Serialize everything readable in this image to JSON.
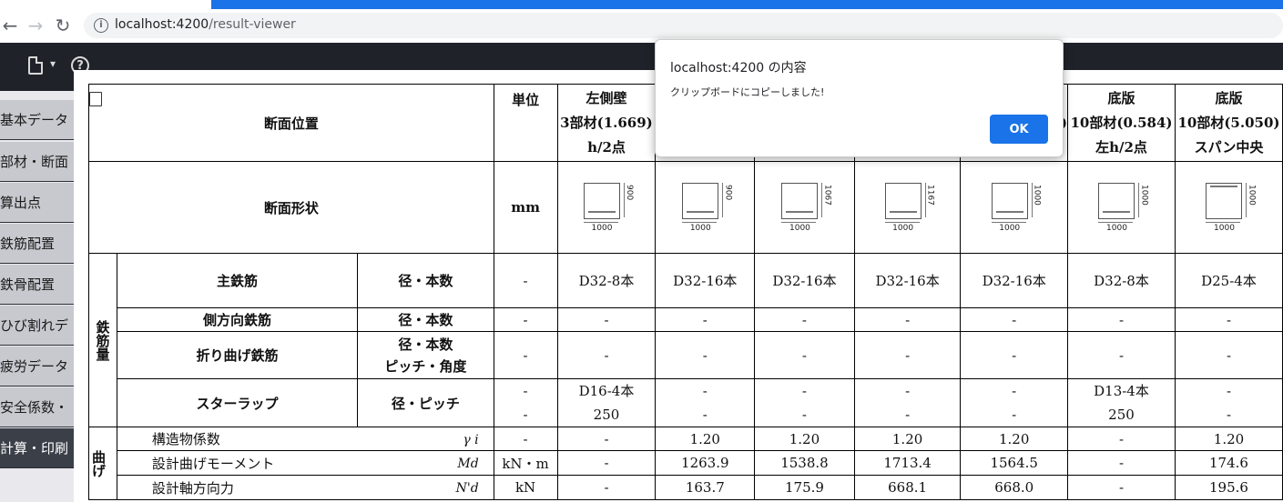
{
  "browser": {
    "url_host": "localhost:4200",
    "url_path": "/result-viewer",
    "back_glyph": "←",
    "forward_glyph": "→",
    "reload_glyph": "↻",
    "info_glyph": "i"
  },
  "toolbar": {
    "caret": "▾",
    "help": "?"
  },
  "sidebar": {
    "items": [
      {
        "label": "基本データ"
      },
      {
        "label": "部材・断面"
      },
      {
        "label": "算出点"
      },
      {
        "label": "鉄筋配置"
      },
      {
        "label": "鉄骨配置"
      },
      {
        "label": "ひび割れデ"
      },
      {
        "label": "疲労データ"
      },
      {
        "label": "安全係数・"
      },
      {
        "label": "計算・印刷"
      }
    ]
  },
  "table": {
    "h_position": "断面位置",
    "h_unit": "単位",
    "columns": [
      {
        "l1": "左側壁",
        "l2": "3部材(1.669)",
        "l3": "h/2点"
      },
      {
        "l1": "",
        "l2": "",
        "l3": ""
      },
      {
        "l1": "",
        "l2": "",
        "l3": ""
      },
      {
        "l1": "",
        "l2": "",
        "l3": ""
      },
      {
        "l1": "",
        "l2": ")",
        "l3": ""
      },
      {
        "l1": "底版",
        "l2": "10部材(0.584)",
        "l3": "左h/2点"
      },
      {
        "l1": "底版",
        "l2": "10部材(5.050)",
        "l3": "スパン中央"
      }
    ],
    "h_shape": "断面形状",
    "shape_unit": "mm",
    "shapes": [
      {
        "w": "1000",
        "h": "900"
      },
      {
        "w": "1000",
        "h": "900"
      },
      {
        "w": "1000",
        "h": "1067"
      },
      {
        "w": "1000",
        "h": "1167"
      },
      {
        "w": "1000",
        "h": "1000"
      },
      {
        "w": "1000",
        "h": "1000"
      },
      {
        "w": "1000",
        "h": "1000"
      }
    ],
    "rebar_group": "鉄筋量",
    "main_rebar": {
      "label": "主鉄筋",
      "sub": "径・本数",
      "unit": "-",
      "values": [
        "D32-8本",
        "D32-16本",
        "D32-16本",
        "D32-16本",
        "D32-16本",
        "D32-8本",
        "D25-4本"
      ]
    },
    "side_rebar": {
      "label": "側方向鉄筋",
      "sub": "径・本数",
      "unit": "-",
      "values": [
        "-",
        "-",
        "-",
        "-",
        "-",
        "-",
        "-"
      ]
    },
    "bent_rebar": {
      "label": "折り曲げ鉄筋",
      "sub1": "径・本数",
      "sub2": "ピッチ・角度",
      "unit": "-",
      "values": [
        "-",
        "-",
        "-",
        "-",
        "-",
        "-",
        "-"
      ]
    },
    "stirrup": {
      "label": "スターラップ",
      "sub": "径・ピッチ",
      "unit1": "-",
      "unit2": "-",
      "values1": [
        "D16-4本",
        "-",
        "-",
        "-",
        "-",
        "D13-4本",
        "-"
      ],
      "values2": [
        "250",
        "-",
        "-",
        "-",
        "-",
        "250",
        "-"
      ]
    },
    "bend_group": "曲げ",
    "gamma": {
      "label": "構造物係数",
      "sym": "γ i",
      "unit": "-",
      "values": [
        "-",
        "1.20",
        "1.20",
        "1.20",
        "1.20",
        "-",
        "1.20"
      ]
    },
    "md": {
      "label": "設計曲げモーメント",
      "sym": "Md",
      "unit": "kN・m",
      "values": [
        "-",
        "1263.9",
        "1538.8",
        "1713.4",
        "1564.5",
        "-",
        "174.6"
      ]
    },
    "nd": {
      "label": "設計軸方向力",
      "sym": "N'd",
      "unit": "kN",
      "values": [
        "-",
        "163.7",
        "175.9",
        "668.1",
        "668.0",
        "-",
        "195.6"
      ]
    }
  },
  "dialog": {
    "title": "localhost:4200 の内容",
    "message": "クリップボードにコピーしました!",
    "ok_label": "OK",
    "accent": "#1a73e8"
  }
}
